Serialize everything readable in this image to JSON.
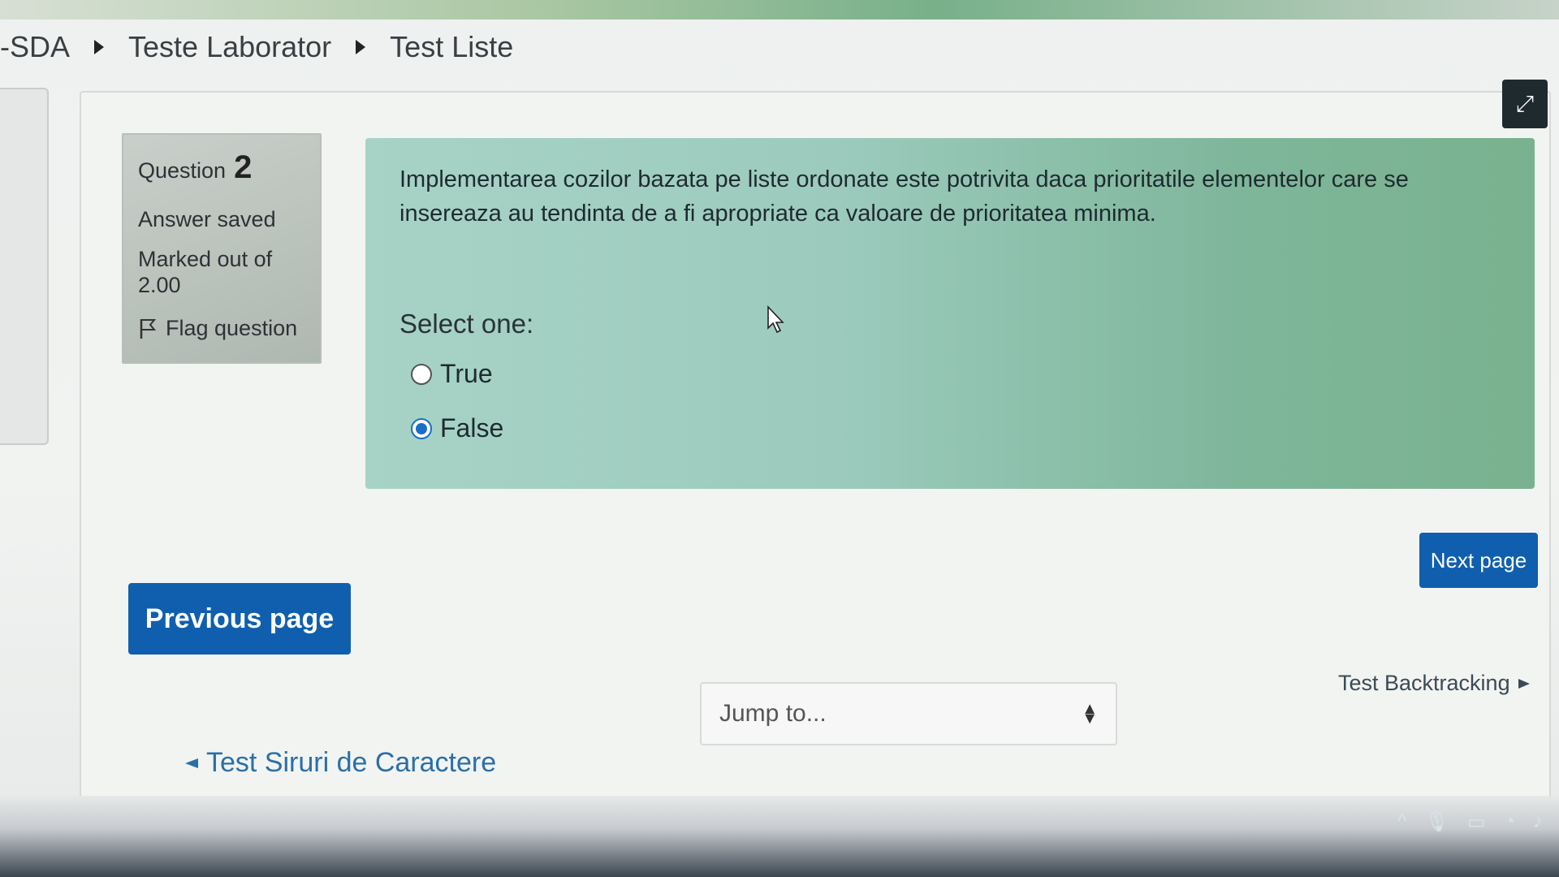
{
  "breadcrumb": [
    "-SDA",
    "Teste Laborator",
    "Test Liste"
  ],
  "question_info": {
    "label": "Question",
    "number": "2",
    "state": "Answer saved",
    "marked_out_of": "Marked out of",
    "grade": "2.00",
    "flag_label": "Flag question"
  },
  "question": {
    "text": "Implementarea cozilor bazata pe liste ordonate este potrivita daca prioritatile elementelor care se insereaza au tendinta de a fi apropriate ca valoare de prioritatea minima.",
    "select_label": "Select one:",
    "options": [
      {
        "label": "True",
        "selected": false
      },
      {
        "label": "False",
        "selected": true
      }
    ]
  },
  "buttons": {
    "previous": "Previous page",
    "next": "Next page"
  },
  "navigation": {
    "prev_activity": "Test Siruri de Caractere",
    "next_activity": "Test Backtracking",
    "jump_placeholder": "Jump to..."
  },
  "colors": {
    "primary_button": "#0f5fae",
    "selected_radio": "#1a6ec7",
    "question_bg": "#9ccbbd"
  }
}
